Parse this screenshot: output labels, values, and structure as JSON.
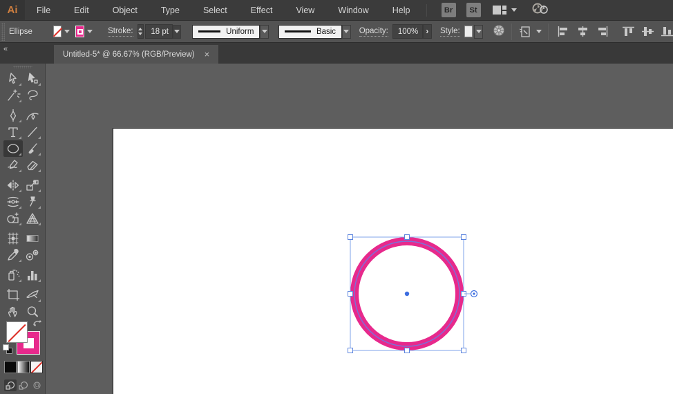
{
  "app": {
    "logo_text": "Ai"
  },
  "menubar": {
    "items": [
      "File",
      "Edit",
      "Object",
      "Type",
      "Select",
      "Effect",
      "View",
      "Window",
      "Help"
    ],
    "bridge_label": "Br",
    "stock_label": "St"
  },
  "controlbar": {
    "selection_type_label": "Ellipse",
    "stroke_label": "Stroke:",
    "stroke_weight": "18 pt",
    "variable_width_profile": "Uniform",
    "brush_definition": "Basic",
    "opacity_label": "Opacity:",
    "opacity_value": "100%",
    "opacity_arrow": "›",
    "style_label": "Style:"
  },
  "tabbar": {
    "collapse_glyph": "«",
    "document_tab": {
      "title": "Untitled-5* @ 66.67% (RGB/Preview)",
      "close_glyph": "×"
    }
  },
  "toolbar": {
    "selected_tool": "ellipse",
    "tools": [
      "selection",
      "direct-selection",
      "magic-wand",
      "lasso",
      "pen",
      "curvature",
      "type",
      "line-segment",
      "ellipse",
      "paintbrush",
      "shaper",
      "eraser",
      "rotate-reflect",
      "scale",
      "width",
      "puppet-warp",
      "shape-builder",
      "perspective-grid",
      "mesh",
      "gradient",
      "eyedropper",
      "blend",
      "symbol-sprayer",
      "column-graph",
      "artboard",
      "slice",
      "hand",
      "zoom"
    ],
    "fill_stroke_proxy": {
      "fill": "none",
      "stroke_color": "#E7298C"
    },
    "color_buttons": [
      "color",
      "gradient",
      "none"
    ],
    "drawing_modes": [
      "draw-normal",
      "draw-behind",
      "draw-inside"
    ],
    "selected_drawing_mode": "draw-normal"
  },
  "canvas": {
    "artboard_color": "#FFFFFF",
    "shape": {
      "type": "ellipse",
      "fill": "none",
      "stroke_color": "#E7298C",
      "stroke_weight": "18 pt"
    }
  },
  "colors": {
    "stroke_pink": "#E7298C",
    "selection_blue": "#7FA3E8",
    "anchor_blue": "#3D6EE0",
    "logo_orange": "#CE7E3F",
    "ui_gray": "#535353",
    "canvas_gray": "#5E5E5E"
  },
  "icons": {
    "top": [
      "workspace-switcher-icon",
      "gpu-performance-icon"
    ],
    "controlbar": [
      "recolor-artwork-icon",
      "select-similar-icon",
      "align-horizontal-left-icon",
      "align-horizontal-center-icon",
      "align-horizontal-right-icon",
      "align-vertical-top-icon",
      "align-vertical-center-icon",
      "align-vertical-bottom-icon"
    ]
  }
}
